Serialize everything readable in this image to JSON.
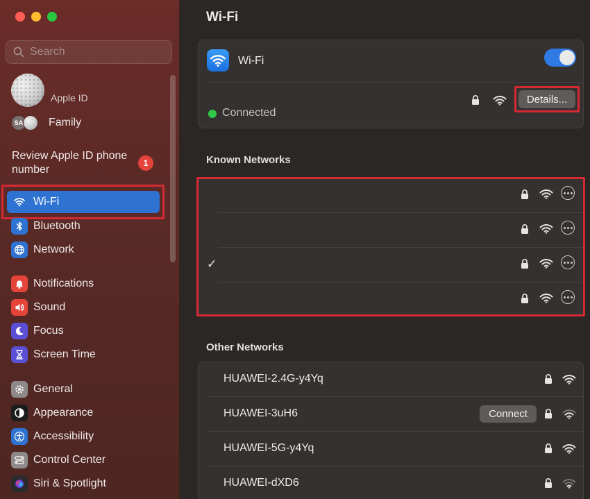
{
  "window": {
    "controls": [
      "close",
      "minimize",
      "zoom"
    ]
  },
  "sidebar": {
    "search": {
      "placeholder": "Search",
      "value": ""
    },
    "apple_id": {
      "label": "Apple ID"
    },
    "family": {
      "initials": "SA",
      "label": "Family"
    },
    "review": {
      "label": "Review Apple ID phone number",
      "badge_count": "1"
    },
    "items": [
      {
        "label": "Wi-Fi",
        "icon": "wifi-icon",
        "icon_bg": "#2e72d2",
        "active": true
      },
      {
        "label": "Bluetooth",
        "icon": "bluetooth-icon",
        "icon_bg": "#2e72d2"
      },
      {
        "label": "Network",
        "icon": "globe-icon",
        "icon_bg": "#2e72d2"
      },
      {
        "label": "Notifications",
        "icon": "bell-icon",
        "icon_bg": "#e5443b"
      },
      {
        "label": "Sound",
        "icon": "speaker-icon",
        "icon_bg": "#e5443b"
      },
      {
        "label": "Focus",
        "icon": "moon-icon",
        "icon_bg": "#5b4fd6"
      },
      {
        "label": "Screen Time",
        "icon": "hourglass-icon",
        "icon_bg": "#5b4fd6"
      },
      {
        "label": "General",
        "icon": "gear-icon",
        "icon_bg": "#8e8a89"
      },
      {
        "label": "Appearance",
        "icon": "appearance-icon",
        "icon_bg": "#1c1c1c"
      },
      {
        "label": "Accessibility",
        "icon": "accessibility-icon",
        "icon_bg": "#2e72d2"
      },
      {
        "label": "Control Center",
        "icon": "control-center-icon",
        "icon_bg": "#8e8a89"
      },
      {
        "label": "Siri & Spotlight",
        "icon": "siri-icon",
        "icon_bg": "#2b2b2b"
      }
    ]
  },
  "main": {
    "title": "Wi-Fi",
    "wifi_card": {
      "title": "Wi-Fi",
      "enabled": true,
      "status": "Connected",
      "details_label": "Details..."
    },
    "known_networks": {
      "title": "Known Networks",
      "rows": [
        {
          "checked": false
        },
        {
          "checked": false
        },
        {
          "checked": true,
          "check": "✓"
        },
        {
          "checked": false
        }
      ]
    },
    "other_networks": {
      "title": "Other Networks",
      "rows": [
        {
          "name": "HUAWEI-2.4G-y4Yq",
          "signal": "strong"
        },
        {
          "name": "HUAWEI-3uH6",
          "signal": "weak",
          "connect_label": "Connect"
        },
        {
          "name": "HUAWEI-5G-y4Yq",
          "signal": "strong"
        },
        {
          "name": "HUAWEI-dXD6",
          "signal": "weak"
        }
      ]
    }
  },
  "colors": {
    "accent": "#2e72d2",
    "highlight_outline": "#d52a33",
    "connected": "#30c94a",
    "sidebar_bg": "#5a2a26",
    "main_bg": "#2b2725"
  }
}
